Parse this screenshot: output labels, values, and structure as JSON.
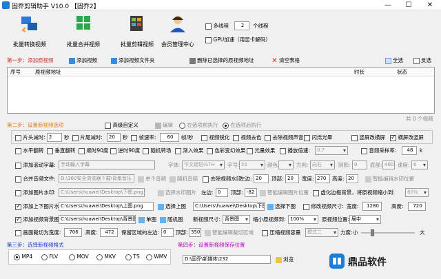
{
  "window": {
    "title": "固乔剪辑助手 V10.0 【固乔2】",
    "controls": [
      "—",
      "☐",
      "✕"
    ]
  },
  "toolbar": {
    "items": [
      {
        "label": "批量转换视频"
      },
      {
        "label": "批量合并视频"
      },
      {
        "label": "批量剪辑视频"
      },
      {
        "label": "会员管理中心"
      }
    ],
    "multithread_label": "多线程",
    "thread_count": "2",
    "thread_unit": "个线程",
    "gpu_label": "GPU加速（用显卡解码）"
  },
  "step1": {
    "label": "第一步：添加原视频",
    "add_video": "添加视频",
    "add_folder": "添加视频文件夹",
    "delete_selected": "删除已选择的原视频地址",
    "clear_table": "清空表格",
    "select_all": "全选",
    "invert": "反选",
    "columns": [
      "序号",
      "原视频地址",
      "时长",
      "状态"
    ],
    "count": "共 0 个视频"
  },
  "step2": {
    "label": "第二步：设置新视频选项",
    "advanced": "高级自定义",
    "edit": "编辑",
    "before": "在选项前执行",
    "after": "在选项后执行",
    "row1": {
      "head_cut": "片头减时:",
      "head_val": "2",
      "head_unit": "秒",
      "tail_cut": "片尾减时:",
      "tail_val": "20",
      "tail_unit": "秒",
      "fps_label": "帧速率:",
      "fps_val": "60",
      "fps_unit": "帧/秒",
      "sharpen": "视频锐化",
      "decolor": "视频去色",
      "remove_audio": "去除视频声音",
      "flash": "闪烁光晕",
      "vertical_blur": "竖屏改横屏",
      "horizontal_blur": "横屏改竖屏"
    },
    "row2": {
      "hflip": "水平翻转",
      "vflip": "垂直翻转",
      "rot90": "顺时90度",
      "rot90ccw": "逆时90度",
      "mirror": "随机转场",
      "fade": "渐入效果",
      "color_fx": "色彩变幻效果",
      "light_fx": "光量效果",
      "speed_label": "播放倍速:",
      "speed_val": "0.7",
      "sample_label": "音频采样率:",
      "sample_val": "48",
      "sample_unit": "k"
    },
    "row3": {
      "subtitle": "添加滚动字幕:",
      "subtitle_ph": "手动输入字幕",
      "font_label": "字体:",
      "font_val": "华文琥珀(STH",
      "size_label": "字号:",
      "size_val": "55",
      "color_label": "颜色:",
      "dir_label": "方向:",
      "dir_val": "向右",
      "shadow_label": "阴影:",
      "shadow_val": "0",
      "bottom_label": "底部:",
      "bottom_val": "400",
      "speed_label": "速度:",
      "speed_val": "6"
    },
    "row4": {
      "merge_audio": "合并音频文件:",
      "merge_path": "D:\\360安全浏览器下载\\背景音乐",
      "single_audio": "单个音频",
      "random_audio": "随机音频",
      "remove_wm": "去除视频水印",
      "left_label": "左边:",
      "left_val": "20",
      "top_label": "顶部:",
      "top_val": "20",
      "width_label": "宽度:",
      "width_val": "270",
      "height_label": "高度:",
      "height_val": "20",
      "smart_locate": "智能编辑水印位置"
    },
    "row5": {
      "image_wm": "添加图片水印:",
      "image_path": "C:\\Users\\huawei\\Desktop\\下图.png",
      "open_image": "选择水印图片",
      "left_label": "左边:",
      "left_val": "0",
      "top_label": "顶部:",
      "top_val": "-82",
      "smart_wm": "智能编辑图片位置",
      "virtual_bg": "虚化边框背景，将原视频缩小到:",
      "scale_val": "80%"
    },
    "row6": {
      "updown": "添加上下图片水印:",
      "up_path": "C:\\Users\\huawei\\Desktop\\上图.png",
      "choose_up": "选择上图",
      "down_path": "C:\\Users\\huawei\\Desktop\\下图.png",
      "choose_down": "选择下图",
      "resize": "修改视频尺寸:",
      "width_label": "宽度:",
      "width_val": "1280",
      "height_label": "高度:",
      "height_val": "720"
    },
    "row7": {
      "bg_image": "添加视频背景图片:",
      "bg_path": "C:\\Users\\huawei\\Desktop\\背景图.png",
      "single": "单图",
      "random": "随机图",
      "new_size": "新视频尺寸:",
      "new_size_val": "背景图",
      "shrink": "缩小原视频到:",
      "shrink_val": "100%",
      "position": "原视频位置:",
      "position_val": "居中"
    },
    "row8": {
      "crop": "画面裁切为宽度:",
      "crop_w": "706",
      "height_label": "高度:",
      "crop_h": "472",
      "keep_left": "保留区域的左边:",
      "keep_left_val": "0",
      "top_label": "顶部:",
      "top_val": "350",
      "smart_crop": "智能编辑裁切区域",
      "compress": "压缩视频容量",
      "mode_val": "模式二",
      "strength": "力度:",
      "small": "小",
      "large": "大"
    }
  },
  "step3": {
    "label": "第三步：选择新视频格式",
    "formats": [
      "MP4",
      "FLV",
      "MOV",
      "MKV",
      "TS",
      "WMV"
    ],
    "selected": "MP4"
  },
  "step4": {
    "label": "第四步：设置新视频保存位置",
    "path": "D:\\固乔\\新媒体\\232",
    "browse": "浏览"
  },
  "watermark": {
    "brand": "鼎品软件"
  },
  "colors": {
    "step_red": "#d42a1e",
    "step_pink": "#c000c0",
    "accent_blue": "#1a35c8"
  }
}
